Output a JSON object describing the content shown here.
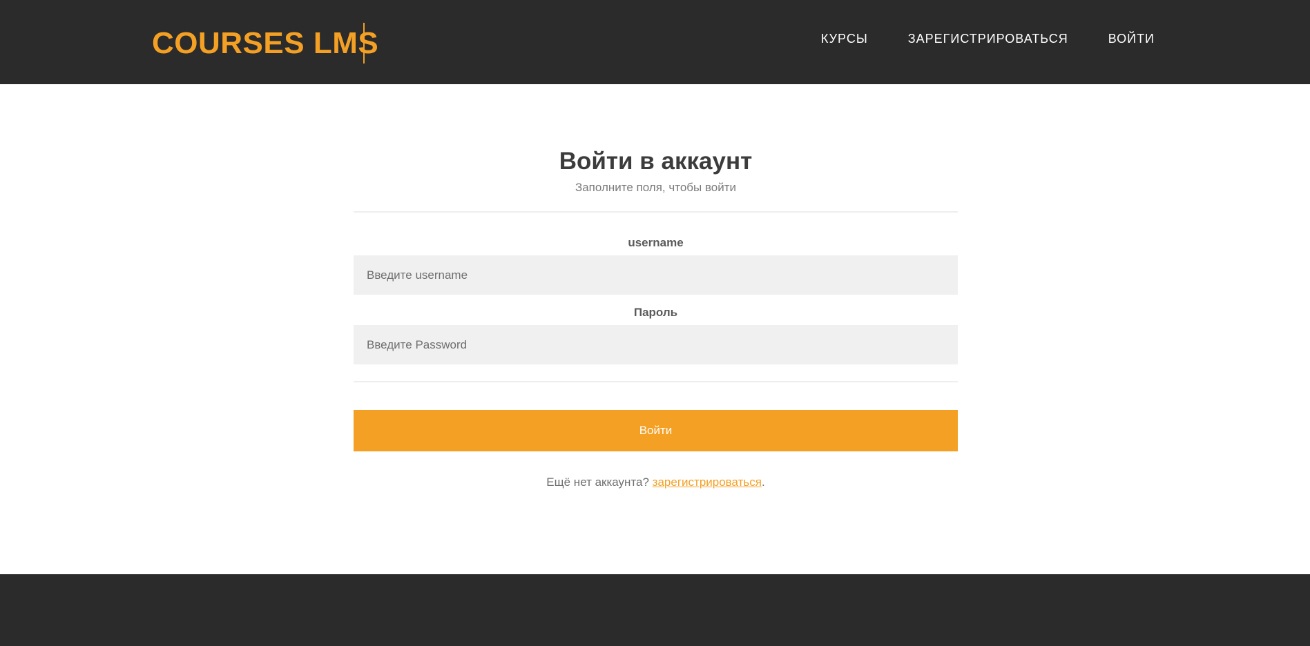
{
  "header": {
    "logo": "COURSES LMS",
    "nav": {
      "courses": "КУРСЫ",
      "register": "ЗАРЕГИСТРИРОВАТЬСЯ",
      "login": "ВОЙТИ"
    }
  },
  "form": {
    "title": "Войти в аккаунт",
    "subtitle": "Заполните поля, чтобы войти",
    "username_label": "username",
    "username_value": "",
    "username_placeholder": "Введите username",
    "password_label": "Пароль",
    "password_value": "",
    "password_placeholder": "Введите Password",
    "submit_label": "Войти",
    "signup_prompt": "Ещё нет аккаунта? ",
    "signup_link": "зарегистрироваться",
    "signup_suffix": "."
  },
  "colors": {
    "accent": "#f4a024",
    "header_bg": "#2b2b2b",
    "input_bg": "#f0f0f0"
  }
}
